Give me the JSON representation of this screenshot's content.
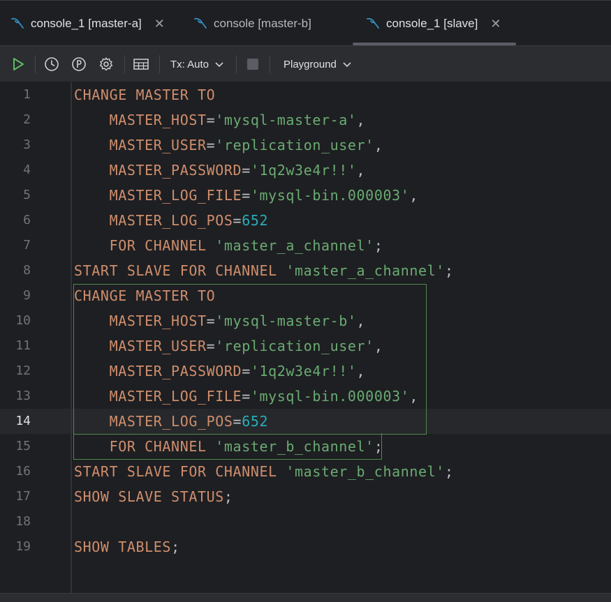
{
  "tabs": [
    {
      "label": "console_1 [master-a]",
      "closable": true,
      "active": false
    },
    {
      "label": "console [master-b]",
      "closable": false,
      "active": false
    },
    {
      "label": "console_1 [slave]",
      "closable": true,
      "active": true
    }
  ],
  "toolbar": {
    "run_icon": "play-icon",
    "history_icon": "clock-icon",
    "plan_icon": "explain-plan-icon",
    "settings_icon": "gear-icon",
    "output_icon": "table-output-icon",
    "tx_label": "Tx: Auto",
    "stop_icon": "stop-icon",
    "schema_label": "Playground"
  },
  "colors": {
    "keyword": "#cf8e6d",
    "string": "#6aab73",
    "number": "#2aacb8",
    "plain": "#bcbec4",
    "run_green": "#5fb865",
    "db_icon_blue": "#3592c4"
  },
  "editor": {
    "current_line": 14,
    "lines": [
      {
        "n": "1",
        "tokens": [
          {
            "t": "CHANGE MASTER TO",
            "c": "kw"
          }
        ]
      },
      {
        "n": "2",
        "tokens": [
          {
            "t": "    MASTER_HOST",
            "c": "kw"
          },
          {
            "t": "=",
            "c": "pl"
          },
          {
            "t": "'mysql-master-a'",
            "c": "str"
          },
          {
            "t": ",",
            "c": "pl"
          }
        ]
      },
      {
        "n": "3",
        "tokens": [
          {
            "t": "    MASTER_USER",
            "c": "kw"
          },
          {
            "t": "=",
            "c": "pl"
          },
          {
            "t": "'replication_user'",
            "c": "str"
          },
          {
            "t": ",",
            "c": "pl"
          }
        ]
      },
      {
        "n": "4",
        "tokens": [
          {
            "t": "    MASTER_PASSWORD",
            "c": "kw"
          },
          {
            "t": "=",
            "c": "pl"
          },
          {
            "t": "'1q2w3e4r!!'",
            "c": "str"
          },
          {
            "t": ",",
            "c": "pl"
          }
        ]
      },
      {
        "n": "5",
        "tokens": [
          {
            "t": "    MASTER_LOG_FILE",
            "c": "kw"
          },
          {
            "t": "=",
            "c": "pl"
          },
          {
            "t": "'mysql-bin.000003'",
            "c": "str"
          },
          {
            "t": ",",
            "c": "pl"
          }
        ]
      },
      {
        "n": "6",
        "tokens": [
          {
            "t": "    MASTER_LOG_POS",
            "c": "kw"
          },
          {
            "t": "=",
            "c": "pl"
          },
          {
            "t": "652",
            "c": "num"
          }
        ]
      },
      {
        "n": "7",
        "tokens": [
          {
            "t": "    FOR CHANNEL ",
            "c": "kw"
          },
          {
            "t": "'master_a_channel'",
            "c": "str"
          },
          {
            "t": ";",
            "c": "pl"
          }
        ]
      },
      {
        "n": "8",
        "tokens": [
          {
            "t": "START SLAVE FOR CHANNEL ",
            "c": "kw"
          },
          {
            "t": "'master_a_channel'",
            "c": "str"
          },
          {
            "t": ";",
            "c": "pl"
          }
        ]
      },
      {
        "n": "9",
        "tokens": [
          {
            "t": "CHANGE MASTER TO",
            "c": "kw"
          }
        ]
      },
      {
        "n": "10",
        "tokens": [
          {
            "t": "    MASTER_HOST",
            "c": "kw"
          },
          {
            "t": "=",
            "c": "pl"
          },
          {
            "t": "'mysql-master-b'",
            "c": "str"
          },
          {
            "t": ",",
            "c": "pl"
          }
        ]
      },
      {
        "n": "11",
        "tokens": [
          {
            "t": "    MASTER_USER",
            "c": "kw"
          },
          {
            "t": "=",
            "c": "pl"
          },
          {
            "t": "'replication_user'",
            "c": "str"
          },
          {
            "t": ",",
            "c": "pl"
          }
        ]
      },
      {
        "n": "12",
        "tokens": [
          {
            "t": "    MASTER_PASSWORD",
            "c": "kw"
          },
          {
            "t": "=",
            "c": "pl"
          },
          {
            "t": "'1q2w3e4r!!'",
            "c": "str"
          },
          {
            "t": ",",
            "c": "pl"
          }
        ]
      },
      {
        "n": "13",
        "tokens": [
          {
            "t": "    MASTER_LOG_FILE",
            "c": "kw"
          },
          {
            "t": "=",
            "c": "pl"
          },
          {
            "t": "'mysql-bin.000003'",
            "c": "str"
          },
          {
            "t": ",",
            "c": "pl"
          }
        ]
      },
      {
        "n": "14",
        "tokens": [
          {
            "t": "    MASTER_LOG_POS",
            "c": "kw"
          },
          {
            "t": "=",
            "c": "pl"
          },
          {
            "t": "652",
            "c": "num"
          }
        ]
      },
      {
        "n": "15",
        "tokens": [
          {
            "t": "    FOR CHANNEL ",
            "c": "kw"
          },
          {
            "t": "'master_b_channel'",
            "c": "str"
          },
          {
            "t": ";",
            "c": "pl"
          }
        ]
      },
      {
        "n": "16",
        "tokens": [
          {
            "t": "START SLAVE FOR CHANNEL ",
            "c": "kw"
          },
          {
            "t": "'master_b_channel'",
            "c": "str"
          },
          {
            "t": ";",
            "c": "pl"
          }
        ]
      },
      {
        "n": "17",
        "tokens": [
          {
            "t": "SHOW SLAVE STATUS",
            "c": "kw"
          },
          {
            "t": ";",
            "c": "pl"
          }
        ]
      },
      {
        "n": "18",
        "tokens": []
      },
      {
        "n": "19",
        "tokens": [
          {
            "t": "SHOW TABLES",
            "c": "kw"
          },
          {
            "t": ";",
            "c": "pl"
          }
        ]
      }
    ]
  }
}
